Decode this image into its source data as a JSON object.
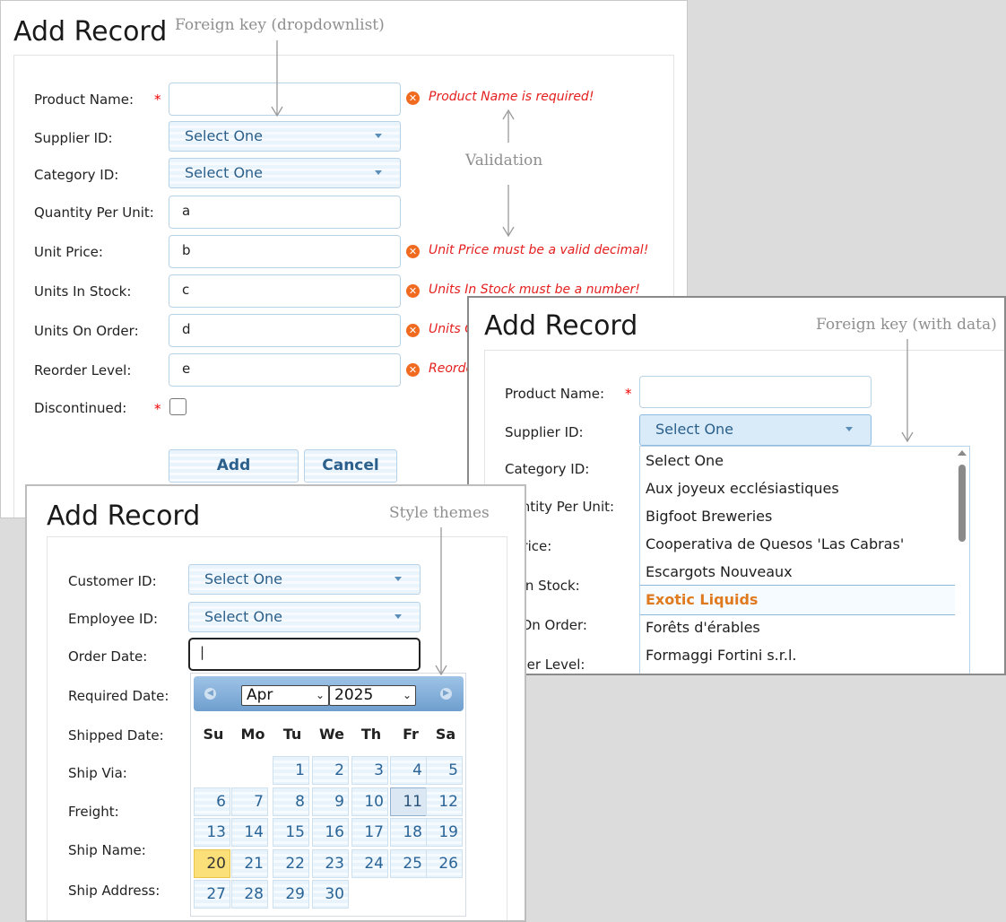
{
  "annotations": {
    "dropdown": "Foreign key (dropdownlist)",
    "validation": "Validation",
    "with_data": "Foreign key (with data)",
    "themes": "Style themes"
  },
  "panel1": {
    "title": "Add Record",
    "fields": [
      {
        "label": "Product Name:",
        "required": true,
        "value": "",
        "error": "Product Name is required!"
      },
      {
        "label": "Supplier ID:",
        "select": "Select One"
      },
      {
        "label": "Category ID:",
        "select": "Select One"
      },
      {
        "label": "Quantity Per Unit:",
        "value": "a"
      },
      {
        "label": "Unit Price:",
        "value": "b",
        "error": "Unit Price must be a valid decimal!"
      },
      {
        "label": "Units In Stock:",
        "value": "c",
        "error": "Units In Stock must be a number!"
      },
      {
        "label": "Units On Order:",
        "value": "d",
        "error": "Units O"
      },
      {
        "label": "Reorder Level:",
        "value": "e",
        "error": "Reorde"
      },
      {
        "label": "Discontinued:",
        "required": true
      }
    ],
    "required_mark": "*",
    "error_icon": "x-circle-icon",
    "buttons": {
      "add": "Add",
      "cancel": "Cancel"
    }
  },
  "panel2": {
    "title": "Add Record",
    "labels": [
      "Product Name:",
      "Supplier ID:",
      "Category ID:",
      "uantity Per Unit:",
      "t Price:",
      "ts In Stock:",
      "ts On Order:",
      "order Level:"
    ],
    "required_mark": "*",
    "supplier_select": "Select One",
    "options": [
      "Select One",
      "Aux joyeux ecclésiastiques",
      "Bigfoot Breweries",
      "Cooperativa de Quesos 'Las Cabras'",
      "Escargots Nouveaux",
      "Exotic Liquids",
      "Forêts d'érables",
      "Formaggi Fortini s.r.l."
    ],
    "highlighted_option": "Exotic Liquids"
  },
  "panel3": {
    "title": "Add Record",
    "labels": [
      "Customer ID:",
      "Employee ID:",
      "Order Date:",
      "Required Date:",
      "Shipped Date:",
      "Ship Via:",
      "Freight:",
      "Ship Name:",
      "Ship Address:"
    ],
    "customer_select": "Select One",
    "employee_select": "Select One",
    "order_date_value": "|",
    "calendar": {
      "month": "Apr",
      "year": "2025",
      "weekdays": [
        "Su",
        "Mo",
        "Tu",
        "We",
        "Th",
        "Fr",
        "Sa"
      ],
      "first_weekday": 2,
      "days_in_month": 30,
      "today": 20,
      "hovered": 11,
      "prev_icon": "chevron-left-icon",
      "next_icon": "chevron-right-icon"
    }
  },
  "colors": {
    "accent": "#2a5f8a",
    "error": "#e41f1f",
    "highlight": "#e07a1f",
    "today": "#fbe07a"
  }
}
